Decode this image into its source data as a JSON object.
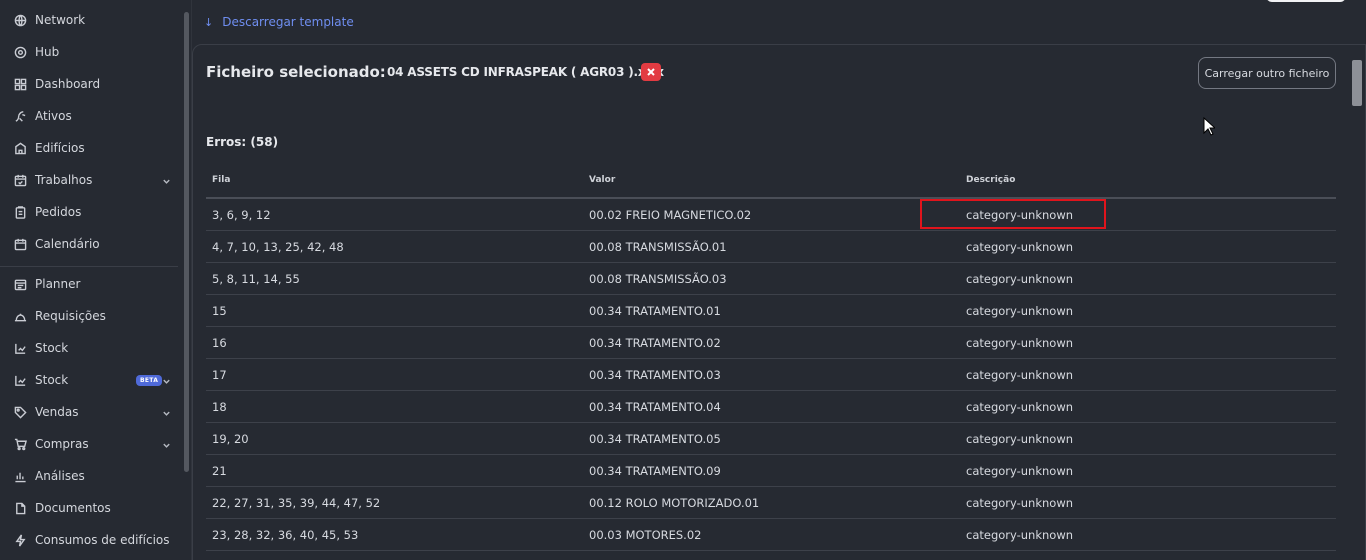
{
  "sidebar": {
    "items": [
      {
        "label": "Network",
        "icon": "globe-icon"
      },
      {
        "label": "Hub",
        "icon": "hub-icon"
      },
      {
        "label": "Dashboard",
        "icon": "dashboard-icon"
      },
      {
        "label": "Ativos",
        "icon": "assets-icon"
      },
      {
        "label": "Edifícios",
        "icon": "building-icon"
      },
      {
        "label": "Trabalhos",
        "icon": "calendar-check-icon"
      },
      {
        "label": "Pedidos",
        "icon": "clipboard-icon"
      },
      {
        "label": "Calendário",
        "icon": "calendar-icon"
      },
      {
        "label": "Planner",
        "icon": "planner-icon"
      },
      {
        "label": "Requisições",
        "icon": "service-bell-icon"
      },
      {
        "label": "Stock",
        "icon": "stock-icon"
      },
      {
        "label": "Stock",
        "icon": "stock-icon",
        "badge": "BETA"
      },
      {
        "label": "Vendas",
        "icon": "tag-icon"
      },
      {
        "label": "Compras",
        "icon": "cart-icon"
      },
      {
        "label": "Análises",
        "icon": "chart-icon"
      },
      {
        "label": "Documentos",
        "icon": "document-icon"
      },
      {
        "label": "Consumos de edifícios",
        "icon": "lightning-icon"
      }
    ]
  },
  "template_link": {
    "label": "Descarregar template",
    "icon": "download-arrow-icon"
  },
  "file": {
    "label": "Ficheiro selecionado:",
    "name": "04 ASSETS CD INFRASPEAK ( AGR03 ).xlsx",
    "upload_label": "Carregar outro ficheiro"
  },
  "errors": {
    "title": "Erros: (58)",
    "columns": [
      "Fila",
      "Valor",
      "Descrição"
    ],
    "rows": [
      [
        "3, 6, 9, 12",
        "00.02 FREIO MAGNETICO.02",
        "category-unknown"
      ],
      [
        "4, 7, 10, 13, 25, 42, 48",
        "00.08 TRANSMISSÃO.01",
        "category-unknown"
      ],
      [
        "5, 8, 11, 14, 55",
        "00.08 TRANSMISSÃO.03",
        "category-unknown"
      ],
      [
        "15",
        "00.34 TRATAMENTO.01",
        "category-unknown"
      ],
      [
        "16",
        "00.34 TRATAMENTO.02",
        "category-unknown"
      ],
      [
        "17",
        "00.34 TRATAMENTO.03",
        "category-unknown"
      ],
      [
        "18",
        "00.34 TRATAMENTO.04",
        "category-unknown"
      ],
      [
        "19, 20",
        "00.34 TRATAMENTO.05",
        "category-unknown"
      ],
      [
        "21",
        "00.34 TRATAMENTO.09",
        "category-unknown"
      ],
      [
        "22, 27, 31, 35, 39, 44, 47, 52",
        "00.12 ROLO MOTORIZADO.01",
        "category-unknown"
      ],
      [
        "23, 28, 32, 36, 40, 45, 53",
        "00.03 MOTORES.02",
        "category-unknown"
      ]
    ]
  },
  "colors": {
    "background": "#262a32",
    "accent": "#6f8ef0",
    "danger": "#e23b42",
    "highlight_box": "#e0141c"
  }
}
